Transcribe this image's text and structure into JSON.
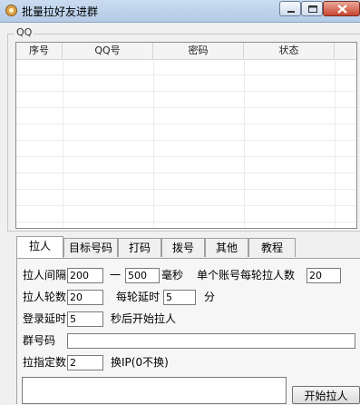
{
  "window": {
    "title": "批量拉好友进群"
  },
  "group": {
    "label": "QQ"
  },
  "grid": {
    "columns": [
      "序号",
      "QQ号",
      "密码",
      "状态"
    ]
  },
  "tabs": [
    {
      "label": "拉人"
    },
    {
      "label": "目标号码"
    },
    {
      "label": "打码"
    },
    {
      "label": "拨号"
    },
    {
      "label": "其他"
    },
    {
      "label": "教程"
    }
  ],
  "settings": {
    "interval_label": "拉人间隔",
    "interval_min": "200",
    "interval_sep": "一",
    "interval_max": "500",
    "interval_unit": "毫秒",
    "per_round_label": "单个账号每轮拉人数",
    "per_round_value": "20",
    "rounds_label": "拉人轮数",
    "rounds_value": "20",
    "round_delay_label": "每轮延时",
    "round_delay_value": "5",
    "round_delay_unit": "分",
    "login_delay_label": "登录延时",
    "login_delay_value": "5",
    "login_delay_suffix": "秒后开始拉人",
    "group_code_label": "群号码",
    "group_code_value": "",
    "specified_count_label": "拉指定数",
    "specified_count_value": "2",
    "switch_ip_label": "换IP(0不换)",
    "start_button": "开始拉人"
  }
}
